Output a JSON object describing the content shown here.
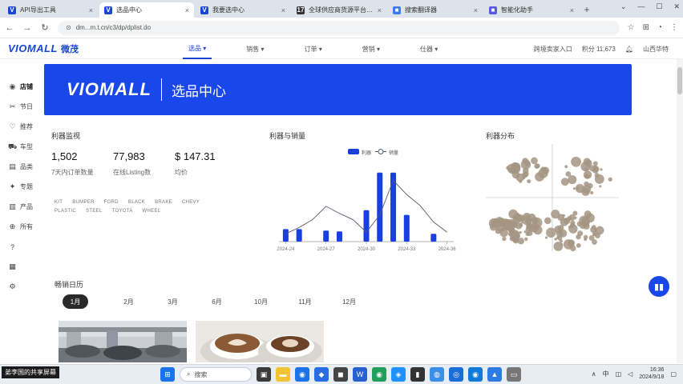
{
  "browser": {
    "tabs": [
      {
        "title": "API导出工具",
        "favicon": "V",
        "color": "#1947d1",
        "active": false
      },
      {
        "title": "选品中心",
        "favicon": "V",
        "color": "#1947d1",
        "active": true
      },
      {
        "title": "我要选中心",
        "favicon": "V",
        "color": "#1947d1",
        "active": false
      },
      {
        "title": "全球供应商货源平台 | 17T",
        "favicon": "17",
        "color": "#333333",
        "active": false
      },
      {
        "title": "搜索翻译器",
        "favicon": "■",
        "color": "#3d7bf0",
        "active": false
      },
      {
        "title": "智能化助手",
        "favicon": "■",
        "color": "#5a5ae0",
        "active": false
      }
    ],
    "new_tab": "+",
    "window_controls": [
      "⌄",
      "—",
      "☐",
      "✕"
    ],
    "url": "dm...m.t.cn/c3/dp/dplist.do"
  },
  "app": {
    "logo": "VIOMALL",
    "logo_cn": "微茂",
    "nav": [
      {
        "label": "选品 ▾",
        "active": true
      },
      {
        "label": "销售 ▾",
        "active": false
      },
      {
        "label": "订单 ▾",
        "active": false
      },
      {
        "label": "营销 ▾",
        "active": false
      },
      {
        "label": "仕器 ▾",
        "active": false
      }
    ],
    "header_right": {
      "link": "跨境卖家入口",
      "balance": "积分 11,673",
      "user": "山西华特"
    }
  },
  "sidebar": [
    {
      "icon": "◉",
      "label": "店铺",
      "active": true
    },
    {
      "icon": "✂",
      "label": "节日",
      "active": false
    },
    {
      "icon": "♡",
      "label": "推荐",
      "active": false
    },
    {
      "icon": "⛟",
      "label": "车型",
      "active": false
    },
    {
      "icon": "▤",
      "label": "品类",
      "active": false
    },
    {
      "icon": "✦",
      "label": "专题",
      "active": false
    },
    {
      "icon": "▥",
      "label": "产品",
      "active": false
    },
    {
      "icon": "⊕",
      "label": "所有",
      "active": false
    },
    {
      "icon": "?",
      "label": "",
      "active": false
    },
    {
      "icon": "▦",
      "label": "",
      "active": false
    },
    {
      "icon": "⚙",
      "label": "",
      "active": false
    }
  ],
  "banner": {
    "logo": "VIOMALL",
    "title": "选品中心"
  },
  "overview": {
    "title": "利器监视",
    "stats": [
      {
        "value": "1,502",
        "label": "7天内订单数量"
      },
      {
        "value": "77,983",
        "label": "在线Listing数"
      },
      {
        "value": "$ 147.31",
        "label": "均价"
      }
    ],
    "tags": [
      "KIT",
      "BUMPER",
      "FORD",
      "BLACK",
      "BRAKE",
      "CHEVY",
      "PLASTIC",
      "STEEL",
      "TOYOTA",
      "WHEEL"
    ]
  },
  "profit_chart_title": "利器与销量",
  "scatter_title": "利器分布",
  "chart_data": [
    {
      "type": "bar",
      "legend": {
        "position": "top",
        "bar_label": "利器",
        "line_label": "销量"
      },
      "x_tick_labels": [
        "2024-24",
        "2024-27",
        "2024-30",
        "2024-33",
        "2024-36"
      ],
      "categories": [
        "2024-24",
        "2024-25",
        "2024-26",
        "2024-27",
        "2024-28",
        "2024-29",
        "2024-30",
        "2024-31",
        "2024-32",
        "2024-33",
        "2024-34",
        "2024-35",
        "2024-36"
      ],
      "series": [
        {
          "name": "利器",
          "kind": "bar",
          "color": "#1a3fe0",
          "values": [
            1.6,
            1.6,
            0,
            1.4,
            1.3,
            0,
            4.0,
            8.8,
            8.8,
            3.4,
            0,
            1.0,
            0
          ]
        },
        {
          "name": "销量",
          "kind": "line",
          "color": "#555b6e",
          "values": [
            1.0,
            1.8,
            2.8,
            4.5,
            3.6,
            2.8,
            1.2,
            3.4,
            7.8,
            6.0,
            4.6,
            2.5,
            1.2
          ]
        }
      ],
      "ylim": [
        0,
        10
      ]
    },
    {
      "type": "scatter",
      "color": "#a49582",
      "clusters": [
        {
          "x": -0.55,
          "y": -0.55,
          "spread": 0.35,
          "count": 70
        },
        {
          "x": 0.3,
          "y": -0.6,
          "spread": 0.45,
          "count": 55
        },
        {
          "x": -0.4,
          "y": 0.5,
          "spread": 0.3,
          "count": 25
        },
        {
          "x": 0.5,
          "y": 0.4,
          "spread": 0.4,
          "count": 30
        }
      ],
      "xlim": [
        -1,
        1
      ],
      "ylim": [
        -1,
        1
      ]
    }
  ],
  "sales_calendar": {
    "title": "畅销日历",
    "months": [
      {
        "label": "1月",
        "active": true
      },
      {
        "label": "2月",
        "active": false
      },
      {
        "label": "3月",
        "active": false
      },
      {
        "label": "6月",
        "active": false
      },
      {
        "label": "10月",
        "active": false
      },
      {
        "label": "11月",
        "active": false
      },
      {
        "label": "12月",
        "active": false
      }
    ]
  },
  "fab_icon": "chat-icon",
  "taskbar": {
    "share_label": "弟李国的共享屏幕",
    "search_placeholder": "搜索",
    "ime": "中",
    "time": "16:36",
    "date": "2024/9/18"
  }
}
